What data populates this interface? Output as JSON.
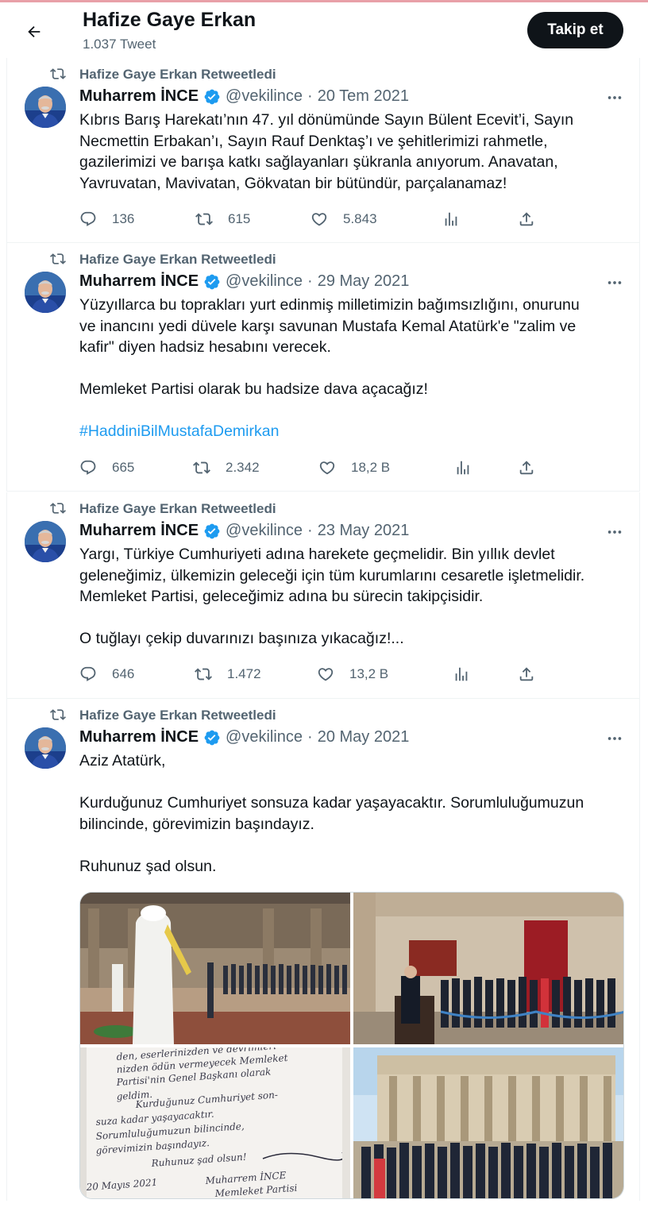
{
  "header": {
    "name": "Hafize Gaye Erkan",
    "tweet_count": "1.037 Tweet",
    "follow_label": "Takip et"
  },
  "tweets": [
    {
      "retweet_label": "Hafize Gaye Erkan Retweetledi",
      "author": "Muharrem İNCE",
      "handle": "@vekilince",
      "dot": "·",
      "date": "20 Tem 2021",
      "lines": [
        "Kıbrıs Barış Harekatı’nın 47. yıl dönümünde Sayın Bülent Ecevit’i, Sayın",
        "Necmettin Erbakan’ı, Sayın Rauf Denktaş’ı ve şehitlerimizi rahmetle,",
        "gazilerimizi ve barışa katkı sağlayanları şükranla anıyorum. Anavatan,",
        "Yavruvatan, Mavivatan, Gökvatan bir bütündür, parçalanamaz!"
      ],
      "replies": "136",
      "retweets": "615",
      "likes": "5.843"
    },
    {
      "retweet_label": "Hafize Gaye Erkan Retweetledi",
      "author": "Muharrem İNCE",
      "handle": "@vekilince",
      "dot": "·",
      "date": "29 May 2021",
      "lines": [
        "Yüzyıllarca bu toprakları yurt edinmiş milletimizin bağımsızlığını, onurunu",
        "ve inancını yedi düvele karşı savunan Mustafa Kemal Atatürk'e \"zalim ve",
        "kafir\" diyen hadsiz hesabını verecek.",
        "Memleket Partisi olarak bu hadsize dava açacağız!"
      ],
      "hashtag": "#HaddiniBilMustafaDemirkan",
      "replies": "665",
      "retweets": "2.342",
      "likes": "18,2 B"
    },
    {
      "retweet_label": "Hafize Gaye Erkan Retweetledi",
      "author": "Muharrem İNCE",
      "handle": "@vekilince",
      "dot": "·",
      "date": "23 May 2021",
      "lines": [
        "Yargı, Türkiye Cumhuriyeti adına harekete geçmelidir. Bin yıllık devlet",
        "geleneğimiz, ülkemizin geleceği için tüm kurumlarını cesaretle işletmelidir.",
        "Memleket Partisi, geleceğimiz adına bu sürecin takipçisidir.",
        "O tuğlayı çekip duvarınızı başınıza yıkacağız!..."
      ],
      "replies": "646",
      "retweets": "1.472",
      "likes": "13,2 B"
    },
    {
      "retweet_label": "Hafize Gaye Erkan Retweetledi",
      "author": "Muharrem İNCE",
      "handle": "@vekilince",
      "dot": "·",
      "date": "20 May 2021",
      "lines": [
        "Aziz Atatürk,",
        "Kurduğunuz Cumhuriyet sonsuza kadar yaşayacaktır. Sorumluluğumuzun",
        "bilincinde, görevimizin başındayız.",
        "Ruhunuz şad olsun."
      ],
      "handwriting": {
        "lines": [
          "den, eserlerinizden ve devrimleri-",
          "nizden ödün vermeyecek Memleket",
          "Partisi'nin Genel Başkanı olarak",
          "geldim.",
          "Kurduğunuz Cumhuriyet son-",
          "suza kadar yaşayacaktır.",
          "Sorumluluğumuzun bilincinde,",
          "görevimizin başındayız.",
          "Ruhunuz şad olsun!"
        ],
        "date": "20 Mayıs 2021",
        "signature": "Muharrem İNCE",
        "party": "Memleket Partisi"
      }
    }
  ]
}
